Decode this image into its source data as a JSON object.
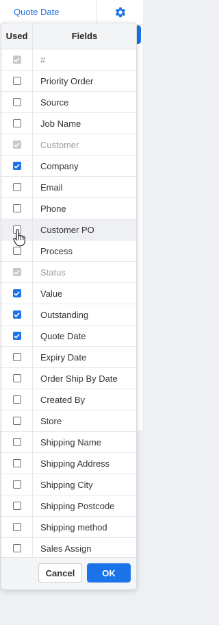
{
  "header": {
    "column_label": "Quote Date",
    "settings_icon": "gear-icon",
    "accent_color": "#1a73e8"
  },
  "panel": {
    "columns": {
      "used": "Used",
      "fields": "Fields"
    },
    "rows": [
      {
        "label": "#",
        "checked": true,
        "disabled": true
      },
      {
        "label": "Priority Order",
        "checked": false,
        "disabled": false
      },
      {
        "label": "Source",
        "checked": false,
        "disabled": false
      },
      {
        "label": "Job Name",
        "checked": false,
        "disabled": false
      },
      {
        "label": "Customer",
        "checked": true,
        "disabled": true
      },
      {
        "label": "Company",
        "checked": true,
        "disabled": false
      },
      {
        "label": "Email",
        "checked": false,
        "disabled": false
      },
      {
        "label": "Phone",
        "checked": false,
        "disabled": false
      },
      {
        "label": "Customer PO",
        "checked": false,
        "disabled": false,
        "hovered": true
      },
      {
        "label": "Process",
        "checked": false,
        "disabled": false
      },
      {
        "label": "Status",
        "checked": true,
        "disabled": true
      },
      {
        "label": "Value",
        "checked": true,
        "disabled": false
      },
      {
        "label": "Outstanding",
        "checked": true,
        "disabled": false
      },
      {
        "label": "Quote Date",
        "checked": true,
        "disabled": false
      },
      {
        "label": "Expiry Date",
        "checked": false,
        "disabled": false
      },
      {
        "label": "Order Ship By Date",
        "checked": false,
        "disabled": false
      },
      {
        "label": "Created By",
        "checked": false,
        "disabled": false
      },
      {
        "label": "Store",
        "checked": false,
        "disabled": false
      },
      {
        "label": "Shipping Name",
        "checked": false,
        "disabled": false
      },
      {
        "label": "Shipping Address",
        "checked": false,
        "disabled": false
      },
      {
        "label": "Shipping City",
        "checked": false,
        "disabled": false
      },
      {
        "label": "Shipping Postcode",
        "checked": false,
        "disabled": false
      },
      {
        "label": "Shipping method",
        "checked": false,
        "disabled": false
      },
      {
        "label": "Sales Assign",
        "checked": false,
        "disabled": false
      }
    ],
    "footer": {
      "cancel_label": "Cancel",
      "ok_label": "OK"
    }
  }
}
